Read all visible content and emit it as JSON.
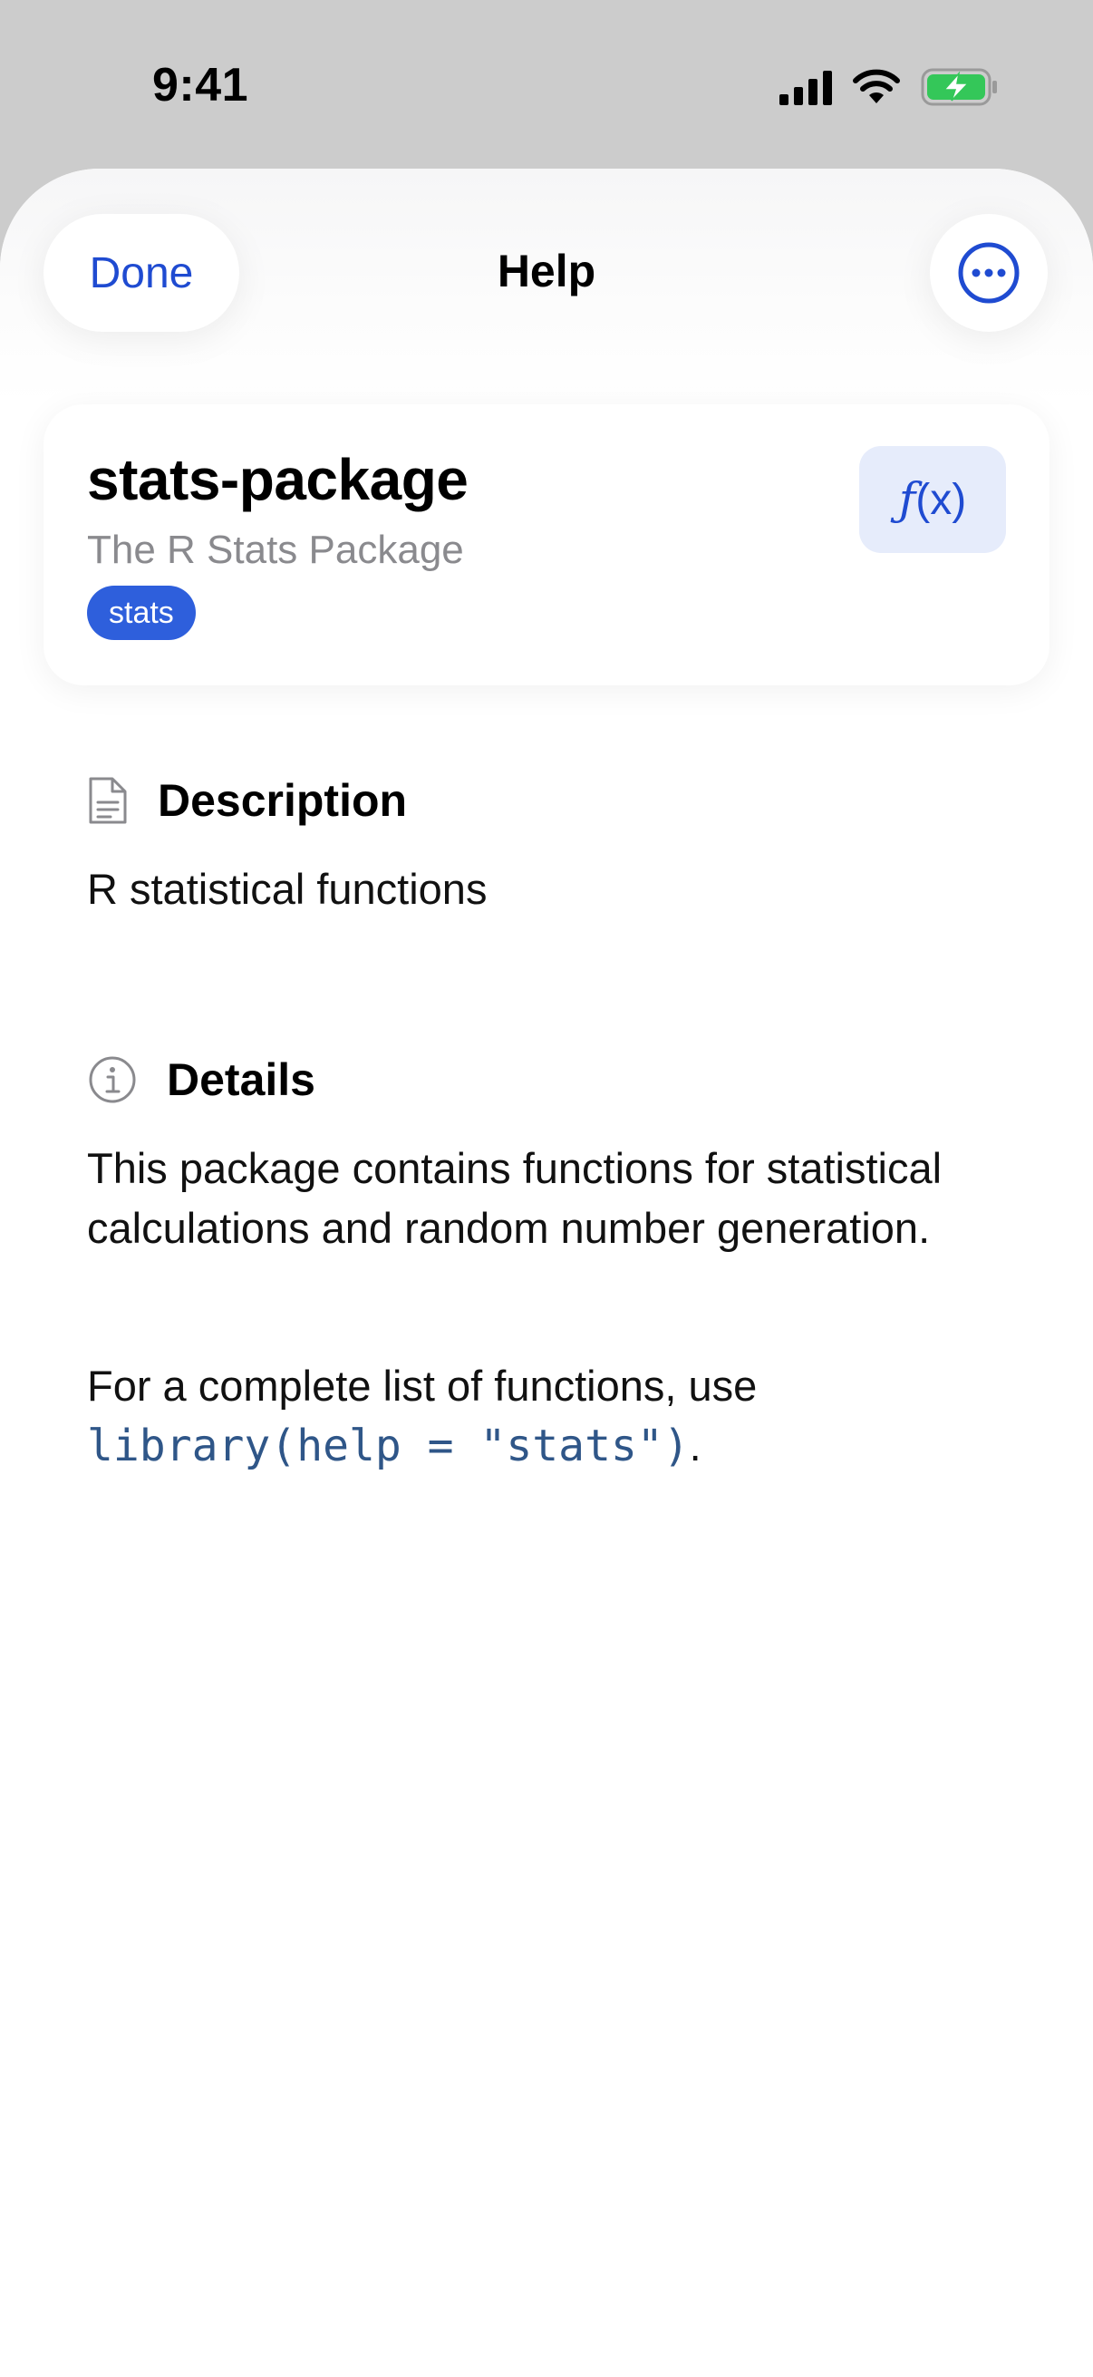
{
  "status_bar": {
    "time": "9:41"
  },
  "nav": {
    "done_label": "Done",
    "title": "Help"
  },
  "package": {
    "name": "stats-package",
    "subtitle": "The R Stats Package",
    "badge": "stats",
    "function_button_f": "ƒ",
    "function_button_x": "(x)"
  },
  "description": {
    "heading": "Description",
    "text": "R statistical functions"
  },
  "details": {
    "heading": "Details",
    "paragraph1": "This package contains functions for statistical calculations and random number generation.",
    "paragraph2_prefix": "For a complete list of functions, use ",
    "paragraph2_code": "library(help = \"stats\")",
    "paragraph2_suffix": "."
  },
  "colors": {
    "accent": "#1f4bd1",
    "badge": "#2e5fdc",
    "battery": "#34c759",
    "code": "#2f5688"
  }
}
